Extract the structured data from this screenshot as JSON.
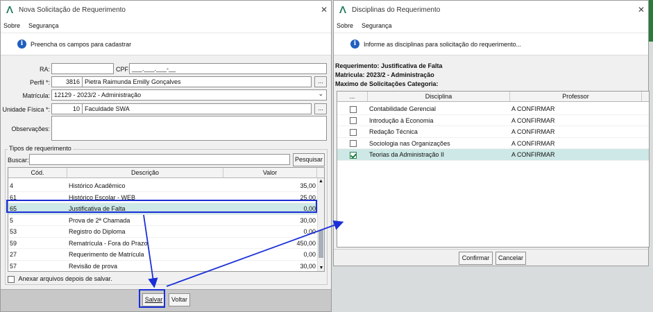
{
  "left": {
    "title": "Nova Solicitação de Requerimento",
    "menu": [
      "Sobre",
      "Segurança"
    ],
    "info": "Preencha os campos para cadastrar",
    "ra_label": "RA:",
    "ra_value": "",
    "cpf_label": "CPF:",
    "cpf_value": "___.___.___-__",
    "perfil_label": "Perfil *:",
    "perfil_code": "3816",
    "perfil_name": "Pietra Raimunda Emilly Gonçalves",
    "matricula_label": "Matrícula:",
    "matricula_value": "12129 - 2023/2 - Administração",
    "unidade_label": "Unidade Física *:",
    "unidade_code": "10",
    "unidade_name": "Faculdade SWA",
    "obs_label": "Observações:",
    "tipos_label": "Tipos de requerimento",
    "buscar_label": "Buscar:",
    "pesquisar": "Pesquisar",
    "ellipsis": "...",
    "columns": [
      "Cód.",
      "Descrição",
      "Valor"
    ],
    "rows": [
      {
        "cod": "4",
        "desc": "Histórico Acadêmico",
        "valor": "35,00"
      },
      {
        "cod": "61",
        "desc": "Histórico Escolar - WEB",
        "valor": "25,00"
      },
      {
        "cod": "65",
        "desc": "Justificativa de Falta",
        "valor": "0,00"
      },
      {
        "cod": "5",
        "desc": "Prova de 2ª Chamada",
        "valor": "30,00"
      },
      {
        "cod": "53",
        "desc": "Registro do Diploma",
        "valor": "0,00"
      },
      {
        "cod": "59",
        "desc": "Rematrícula - Fora do Prazo",
        "valor": "450,00"
      },
      {
        "cod": "27",
        "desc": "Requerimento de Matrícula",
        "valor": "0,00"
      },
      {
        "cod": "57",
        "desc": "Revisão de prova",
        "valor": "30,00"
      }
    ],
    "anexar": "Anexar arquivos depois de salvar.",
    "salvar": "Salvar",
    "voltar": "Voltar"
  },
  "right": {
    "title": "Disciplinas do Requerimento",
    "menu": [
      "Sobre",
      "Segurança"
    ],
    "info": "Informe as disciplinas para solicitação do requerimento...",
    "req_line": "Requerimento: Justificativa de Falta",
    "mat_line": "Matricula: 2023/2 - Administração",
    "max_line": "Maximo de Solicitações Categoria:",
    "columns": [
      "...",
      "Disciplina",
      "Professor"
    ],
    "rows": [
      {
        "checked": false,
        "disciplina": "Contabilidade Gerencial",
        "professor": "A CONFIRMAR"
      },
      {
        "checked": false,
        "disciplina": "Introdução à Economia",
        "professor": "A CONFIRMAR"
      },
      {
        "checked": false,
        "disciplina": "Redação Técnica",
        "professor": "A CONFIRMAR"
      },
      {
        "checked": false,
        "disciplina": "Sociologia nas Organizações",
        "professor": "A CONFIRMAR"
      },
      {
        "checked": true,
        "disciplina": "Teorias da Administração II",
        "professor": "A CONFIRMAR"
      }
    ],
    "confirmar": "Confirmar",
    "cancelar": "Cancelar"
  },
  "colors": {
    "highlight": "#1a2fd8",
    "selected_row": "#cde8e6",
    "info_icon": "#1f5fbf"
  }
}
